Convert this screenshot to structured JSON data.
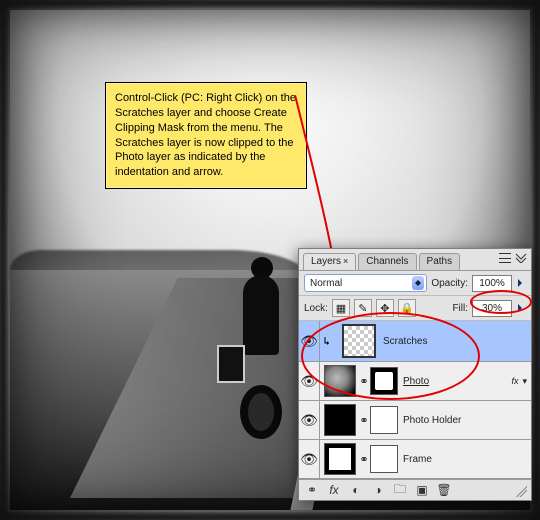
{
  "callout": {
    "text": "Control-Click (PC: Right Click) on the Scratches layer and choose Create Clipping Mask from the menu. The Scratches layer is now clipped to the Photo layer as indicated by the indentation and arrow."
  },
  "panel": {
    "tabs": {
      "layers": "Layers",
      "channels": "Channels",
      "paths": "Paths"
    },
    "blend_mode": "Normal",
    "opacity_label": "Opacity:",
    "opacity_value": "100%",
    "lock_label": "Lock:",
    "fill_label": "Fill:",
    "fill_value": "30%",
    "layers": [
      {
        "name": "Scratches",
        "selected": true,
        "indented": true,
        "fx": false,
        "thumb": "checker",
        "mask": null,
        "underline": false
      },
      {
        "name": "Photo",
        "selected": false,
        "indented": false,
        "fx": true,
        "thumb": "dark",
        "mask": "cutout",
        "underline": true
      },
      {
        "name": "Photo Holder",
        "selected": false,
        "indented": false,
        "fx": false,
        "thumb": "black",
        "mask": "solidw",
        "underline": false
      },
      {
        "name": "Frame",
        "selected": false,
        "indented": false,
        "fx": false,
        "thumb": "frameTh",
        "mask": "solidw",
        "underline": false
      }
    ],
    "lock_icons": {
      "transparency": "trans-lock-icon",
      "paint": "brush-lock-icon",
      "move": "move-lock-icon",
      "all": "lock-all-icon"
    },
    "footer_icons": {
      "link": "link-icon",
      "fx": "fx-icon",
      "mask": "mask-icon",
      "adjust": "adjust-icon",
      "group": "group-icon",
      "new": "new-layer-icon",
      "trash": "trash-icon"
    }
  },
  "icons": {
    "eye": "👁",
    "fx": "fx",
    "close": "×",
    "chevrons": "▾"
  }
}
